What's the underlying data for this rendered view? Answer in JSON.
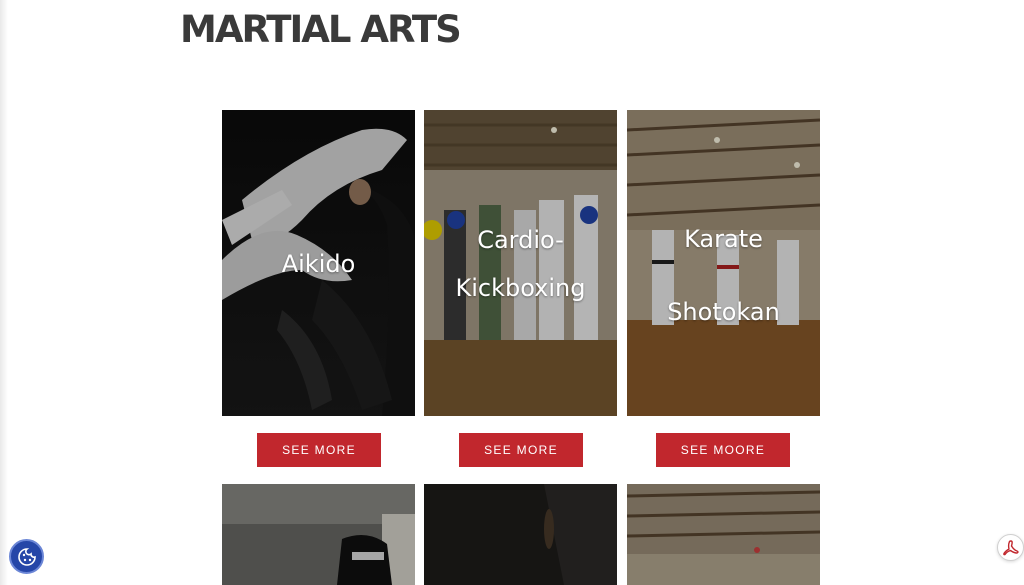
{
  "page": {
    "title": "MARTIAL ARTS"
  },
  "cards": [
    {
      "label_lines": [
        "Aikido"
      ],
      "button": "SEE MORE"
    },
    {
      "label_lines": [
        "Cardio-",
        "Kickboxing"
      ],
      "button": "SEE MORE"
    },
    {
      "label_lines": [
        "Karate",
        "Shotokan"
      ],
      "button": "SEE MOORE"
    }
  ],
  "icons": {
    "cookie": "cookie-icon",
    "pdf": "pdf-icon"
  },
  "colors": {
    "button": "#c1272d",
    "title": "#3a3a3a",
    "cookie_button": "#2546a8"
  }
}
